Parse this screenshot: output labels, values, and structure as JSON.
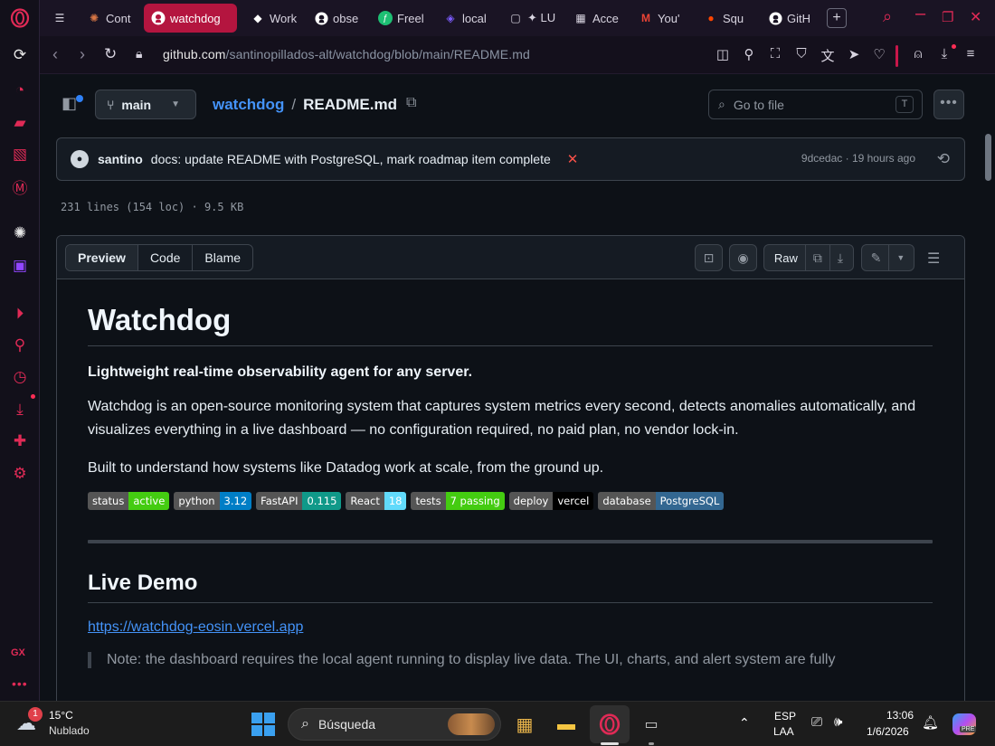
{
  "browser": {
    "tabs": [
      {
        "icon": "☰",
        "label": "",
        "color": "#d8d4e0"
      },
      {
        "icon": "✺",
        "label": "Cont",
        "color": "#d97745"
      },
      {
        "icon": "●",
        "label": "watchdog",
        "color": "#ffffff",
        "active": true
      },
      {
        "icon": "◆",
        "label": "Work",
        "color": "#ffffff"
      },
      {
        "icon": "●",
        "label": "obse",
        "color": "#ffffff"
      },
      {
        "icon": "ƒ",
        "label": "Freel",
        "color": "#1dbf73"
      },
      {
        "icon": "◈",
        "label": "local",
        "color": "#7c5cff"
      },
      {
        "icon": "▢",
        "label": "✦ LU",
        "color": "#d8d4e0"
      },
      {
        "icon": "▦",
        "label": "Acce",
        "color": "#d8d4e0"
      },
      {
        "icon": "M",
        "label": "You'",
        "color": "#ea4335"
      },
      {
        "icon": "●",
        "label": "Squ",
        "color": "#ff4500"
      },
      {
        "icon": "●",
        "label": "GitH",
        "color": "#ffffff"
      }
    ],
    "new_tab": "+",
    "url_host": "github.com",
    "url_path": "/santinopillados-alt/watchdog/blob/main/README.md",
    "sidebar_gx": "GX"
  },
  "repo": {
    "branch": "main",
    "repo_name": "watchdog",
    "separator": "/",
    "file_name": "README.md",
    "goto_placeholder": "Go to file",
    "goto_kbd": "T",
    "commit_author": "santino",
    "commit_message": "docs: update README with PostgreSQL, mark roadmap item complete",
    "commit_status": "✕",
    "commit_meta": "9dcedac · 19 hours ago",
    "file_info": "231 lines (154 loc) · 9.5 KB"
  },
  "file_toolbar": {
    "tabs": [
      "Preview",
      "Code",
      "Blame"
    ],
    "raw_label": "Raw"
  },
  "readme": {
    "title": "Watchdog",
    "lead": "Lightweight real-time observability agent for any server.",
    "para1": "Watchdog is an open-source monitoring system that captures system metrics every second, detects anomalies automatically, and visualizes everything in a live dashboard — no configuration required, no paid plan, no vendor lock-in.",
    "para2": "Built to understand how systems like Datadog work at scale, from the ground up.",
    "badges": [
      {
        "key": "status",
        "value": "active",
        "color": "#4c1"
      },
      {
        "key": "python",
        "value": "3.12",
        "color": "#007ec6"
      },
      {
        "key": "FastAPI",
        "value": "0.115",
        "color": "#109989"
      },
      {
        "key": "React",
        "value": "18",
        "color": "#61dafb"
      },
      {
        "key": "tests",
        "value": "7 passing",
        "color": "#4c1"
      },
      {
        "key": "deploy",
        "value": "vercel",
        "color": "#000000"
      },
      {
        "key": "database",
        "value": "PostgreSQL",
        "color": "#336791"
      }
    ],
    "h2": "Live Demo",
    "demo_link": "https://watchdog-eosin.vercel.app",
    "note": "Note: the dashboard requires the local agent running to display live data. The UI, charts, and alert system are fully"
  },
  "taskbar": {
    "badge": "1",
    "temp": "15°C",
    "condition": "Nublado",
    "search": "Búsqueda",
    "lang1": "ESP",
    "lang2": "LAA",
    "time": "13:06",
    "date": "1/6/2026",
    "copilot_tag": "PRE"
  }
}
